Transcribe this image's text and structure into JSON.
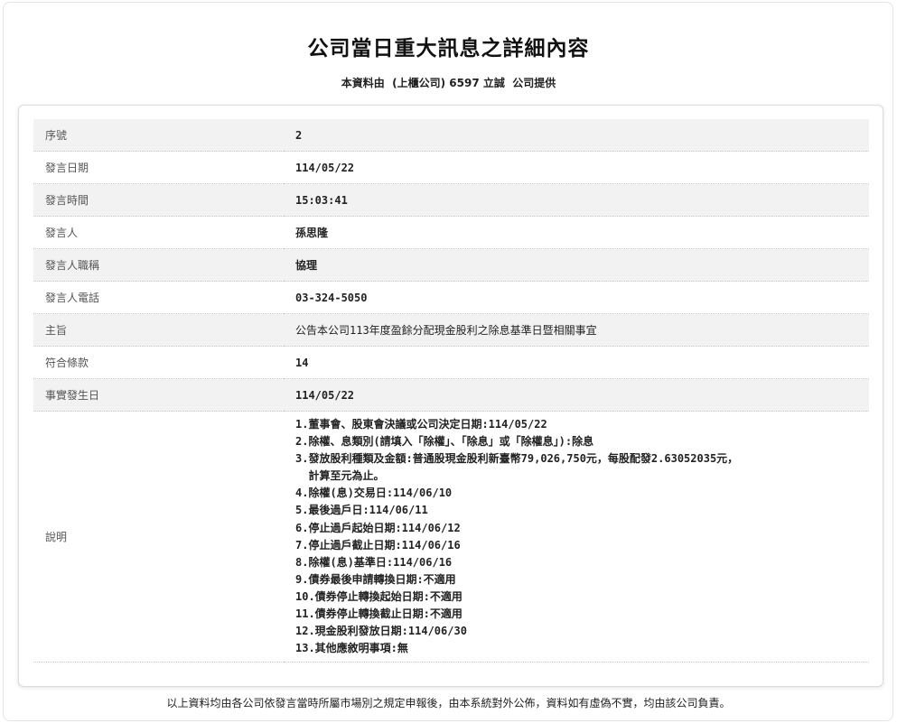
{
  "title": "公司當日重大訊息之詳細內容",
  "subtitle": "本資料由  (上櫃公司) 6597 立誠  公司提供",
  "rows": [
    {
      "label": "序號",
      "value": "2"
    },
    {
      "label": "發言日期",
      "value": "114/05/22"
    },
    {
      "label": "發言時間",
      "value": "15:03:41"
    },
    {
      "label": "發言人",
      "value": "孫思隆"
    },
    {
      "label": "發言人職稱",
      "value": "協理"
    },
    {
      "label": "發言人電話",
      "value": "03-324-5050"
    },
    {
      "label": "主旨",
      "value": "公告本公司113年度盈餘分配現金股利之除息基準日暨相關事宜"
    },
    {
      "label": "符合條款",
      "value": "14"
    },
    {
      "label": "事實發生日",
      "value": "114/05/22"
    }
  ],
  "description": {
    "label": "說明",
    "lines": [
      "1.董事會、股東會決議或公司決定日期:114/05/22",
      "2.除權、息類別(請填入「除權」、「除息」或「除權息」):除息",
      "3.發放股利種類及金額:普通股現金股利新臺幣79,026,750元，每股配發2.63052035元，",
      "  計算至元為止。",
      "4.除權(息)交易日:114/06/10",
      "5.最後過戶日:114/06/11",
      "6.停止過戶起始日期:114/06/12",
      "7.停止過戶截止日期:114/06/16",
      "8.除權(息)基準日:114/06/16",
      "9.債券最後申請轉換日期:不適用",
      "10.債券停止轉換起始日期:不適用",
      "11.債券停止轉換截止日期:不適用",
      "12.現金股利發放日期:114/06/30",
      "13.其他應敘明事項:無"
    ]
  },
  "footer": "以上資料均由各公司依發言當時所屬市場別之規定申報後，由本系統對外公佈，資料如有虛偽不實，均由該公司負責。"
}
